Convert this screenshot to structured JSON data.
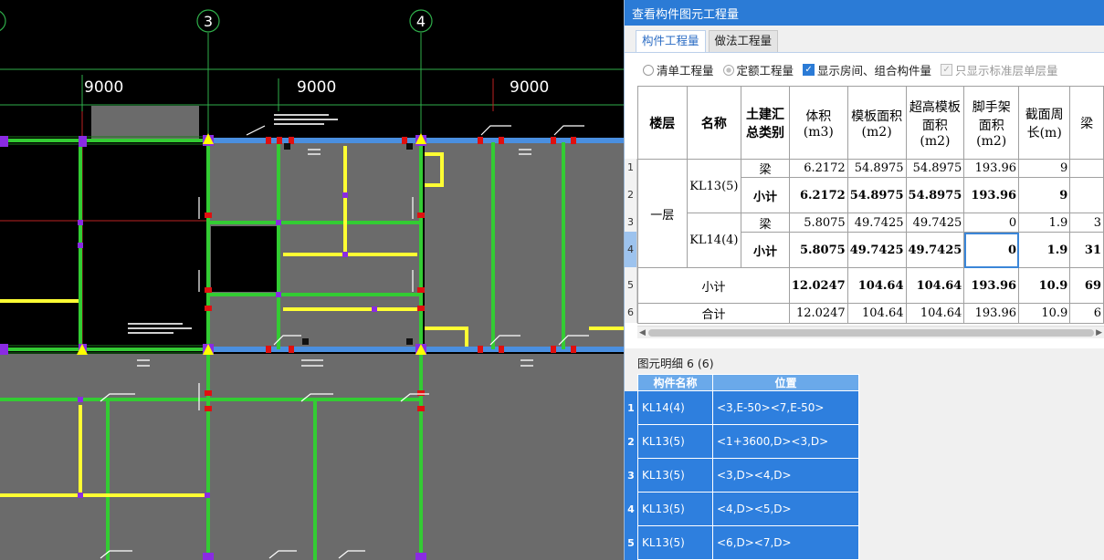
{
  "cad": {
    "axis_labels": [
      "3",
      "4"
    ],
    "dims": [
      "9000",
      "9000",
      "9000"
    ]
  },
  "window": {
    "title": "查看构件图元工程量"
  },
  "tabs": [
    {
      "label": "构件工程量",
      "active": true
    },
    {
      "label": "做法工程量",
      "active": false
    }
  ],
  "options": [
    {
      "label": "清单工程量",
      "kind": "radio",
      "state": "off"
    },
    {
      "label": "定额工程量",
      "kind": "radio",
      "state": "on"
    },
    {
      "label": "显示房间、组合构件量",
      "kind": "checkbox",
      "state": "checked"
    },
    {
      "label": "只显示标准层单层量",
      "kind": "checkbox",
      "state": "disabled"
    }
  ],
  "table": {
    "headers": {
      "floor": "楼层",
      "name": "名称",
      "category": "土建汇总类别",
      "volume": "体积(m3)",
      "formwork": "模板面积(m2)",
      "high_formwork": "超高模板面积(m2)",
      "scaffold": "脚手架面积(m2)",
      "perimeter": "截面周长(m)",
      "beam": "梁"
    },
    "row_numbers": [
      "1",
      "2",
      "3",
      "4",
      "5",
      "6"
    ],
    "floor_label": "一层",
    "groups": [
      {
        "name": "KL13(5)",
        "rows": [
          {
            "category": "梁",
            "volume": "6.2172",
            "formwork": "54.8975",
            "high_formwork": "54.8975",
            "scaffold": "193.96",
            "perimeter": "9",
            "beam": ""
          },
          {
            "category": "小计",
            "volume": "6.2172",
            "formwork": "54.8975",
            "high_formwork": "54.8975",
            "scaffold": "193.96",
            "perimeter": "9",
            "beam": ""
          }
        ]
      },
      {
        "name": "KL14(4)",
        "rows": [
          {
            "category": "梁",
            "volume": "5.8075",
            "formwork": "49.7425",
            "high_formwork": "49.7425",
            "scaffold": "0",
            "perimeter": "1.9",
            "beam": "3"
          },
          {
            "category": "小计",
            "volume": "5.8075",
            "formwork": "49.7425",
            "high_formwork": "49.7425",
            "scaffold": "0",
            "perimeter": "1.9",
            "beam": "31"
          }
        ]
      }
    ],
    "floor_subtotal": {
      "label": "小计",
      "volume": "12.0247",
      "formwork": "104.64",
      "high_formwork": "104.64",
      "scaffold": "193.96",
      "perimeter": "10.9",
      "beam": "69"
    },
    "total": {
      "label": "合计",
      "volume": "12.0247",
      "formwork": "104.64",
      "high_formwork": "104.64",
      "scaffold": "193.96",
      "perimeter": "10.9",
      "beam": "6"
    }
  },
  "detail": {
    "title": "图元明细  6 (6)",
    "headers": {
      "name": "构件名称",
      "position": "位置"
    },
    "rows": [
      {
        "num": "1",
        "name": "KL14(4)",
        "position": "<3,E-50><7,E-50>"
      },
      {
        "num": "2",
        "name": "KL13(5)",
        "position": "<1+3600,D><3,D>"
      },
      {
        "num": "3",
        "name": "KL13(5)",
        "position": "<3,D><4,D>"
      },
      {
        "num": "4",
        "name": "KL13(5)",
        "position": "<4,D><5,D>"
      },
      {
        "num": "5",
        "name": "KL13(5)",
        "position": "<6,D><7,D>"
      }
    ]
  },
  "colors": {
    "title_bar": "#2b7bd6",
    "selected_row": "#2e7fde",
    "beam_green": "#33cc33",
    "beam_blue": "#4a90e0",
    "wall_yellow": "#ffff33",
    "slab_gray": "#6e6e6e"
  }
}
